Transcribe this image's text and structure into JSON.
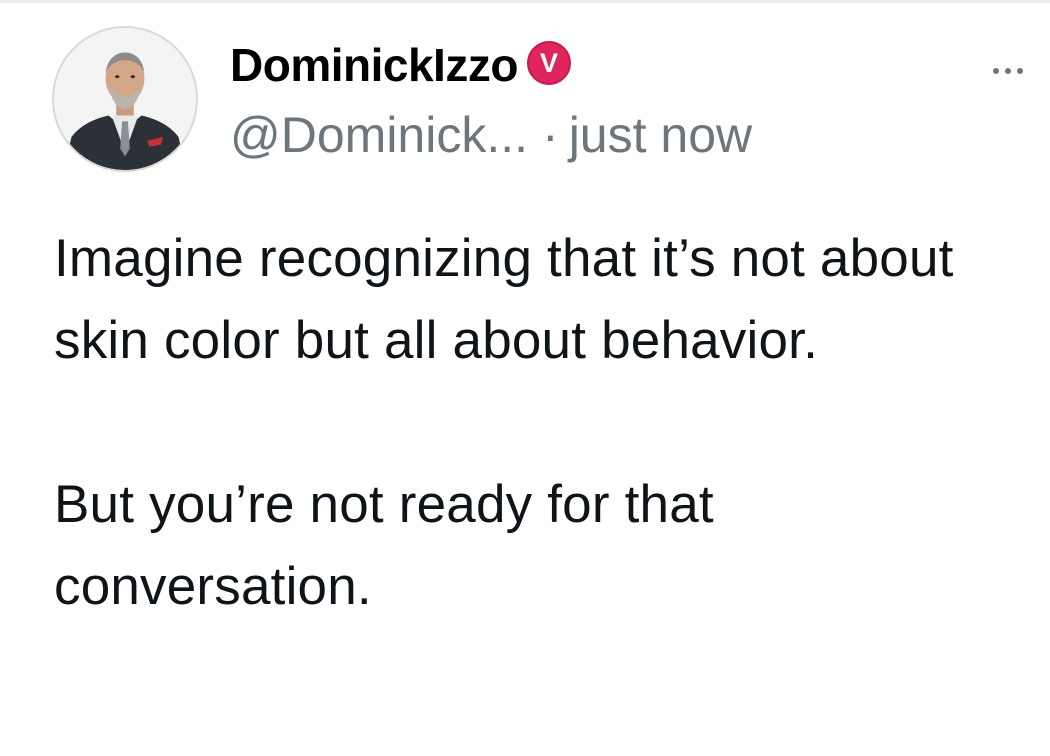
{
  "post": {
    "author": {
      "display_name": "DominickIzzo",
      "verified_badge": {
        "letter": "V",
        "color": "#e0245e",
        "icon": "verified-v-badge-icon"
      },
      "handle": "@Dominick...",
      "separator": "·",
      "timestamp": "just now",
      "avatar_icon": "profile-photo-avatar"
    },
    "more_menu_icon": "more-horizontal-icon",
    "content": {
      "paragraphs": [
        "Imagine recognizing that it’s not about skin color but all about behavior.",
        "But you’re not ready for that conversation."
      ]
    }
  },
  "colors": {
    "text_primary": "#0f1419",
    "text_secondary": "#6e767d",
    "badge_red": "#e0245e",
    "background": "#ffffff"
  }
}
